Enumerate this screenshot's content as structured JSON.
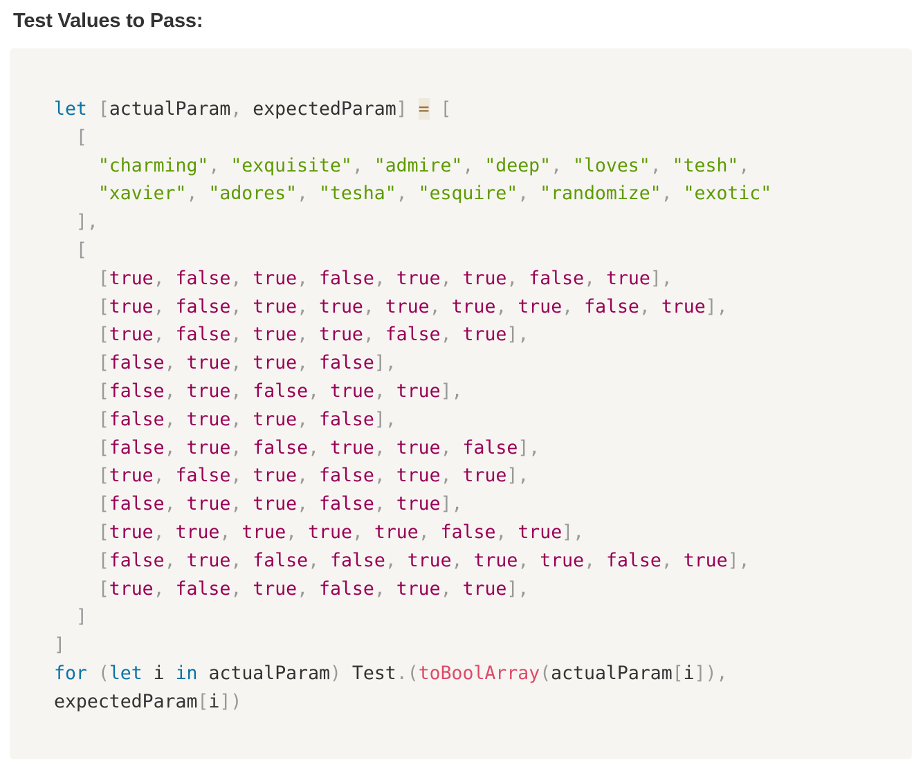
{
  "heading": "Test Values to Pass:",
  "code": {
    "line1": {
      "kw": "let",
      "open": "[",
      "a": "actualParam",
      "comma": ",",
      "b": "expectedParam",
      "close": "]",
      "eq": "=",
      "open2": "["
    },
    "strings_row1": [
      "\"charming\"",
      "\"exquisite\"",
      "\"admire\"",
      "\"deep\"",
      "\"loves\"",
      "\"tesh\""
    ],
    "strings_row2": [
      "\"xavier\"",
      "\"adores\"",
      "\"tesha\"",
      "\"esquire\"",
      "\"randomize\"",
      "\"exotic\""
    ],
    "bool_rows": [
      [
        "true",
        "false",
        "true",
        "false",
        "true",
        "true",
        "false",
        "true"
      ],
      [
        "true",
        "false",
        "true",
        "true",
        "true",
        "true",
        "true",
        "false",
        "true"
      ],
      [
        "true",
        "false",
        "true",
        "true",
        "false",
        "true"
      ],
      [
        "false",
        "true",
        "true",
        "false"
      ],
      [
        "false",
        "true",
        "false",
        "true",
        "true"
      ],
      [
        "false",
        "true",
        "true",
        "false"
      ],
      [
        "false",
        "true",
        "false",
        "true",
        "true",
        "false"
      ],
      [
        "true",
        "false",
        "true",
        "false",
        "true",
        "true"
      ],
      [
        "false",
        "true",
        "true",
        "false",
        "true"
      ],
      [
        "true",
        "true",
        "true",
        "true",
        "true",
        "false",
        "true"
      ],
      [
        "false",
        "true",
        "false",
        "false",
        "true",
        "true",
        "true",
        "false",
        "true"
      ],
      [
        "true",
        "false",
        "true",
        "false",
        "true",
        "true"
      ]
    ],
    "for_line": {
      "kw_for": "for",
      "paren_open": "(",
      "kw_let": "let",
      "var_i": "i",
      "kw_in": "in",
      "actual": "actualParam",
      "paren_close": ")",
      "test": "Test",
      "dot": ".",
      "paren_open2": "(",
      "fn": "toBoolArray",
      "paren_open3": "(",
      "actual2": "actualParam",
      "br_open": "[",
      "idx": "i",
      "br_close": "]",
      "paren_close2": ")",
      "comma": ","
    },
    "last_line": {
      "expected": "expectedParam",
      "br_open": "[",
      "idx": "i",
      "br_close": "]",
      "paren_close": ")"
    }
  }
}
